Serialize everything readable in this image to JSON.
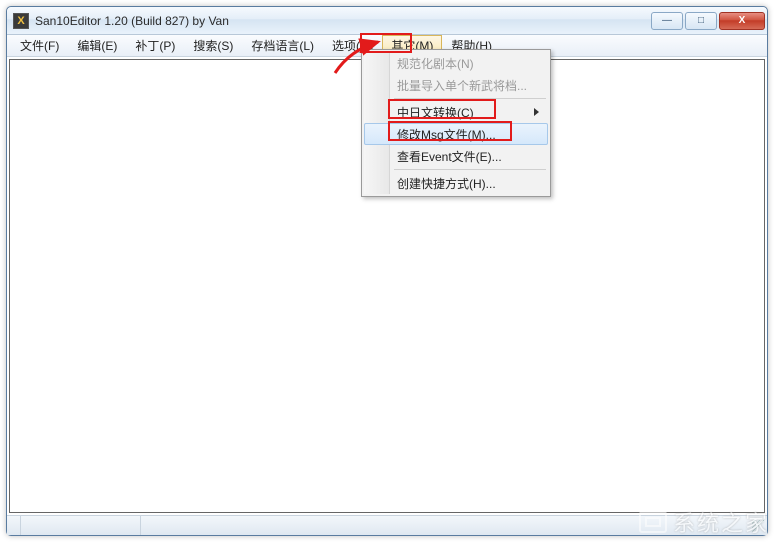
{
  "title": "San10Editor 1.20 (Build 827) by Van",
  "app_icon_letter": "X",
  "window_controls": {
    "min": "—",
    "max": "□",
    "close": "X"
  },
  "menubar": {
    "file": "文件(F)",
    "edit": "编辑(E)",
    "patch": "补丁(P)",
    "search": "搜索(S)",
    "lang": "存档语言(L)",
    "options": "选项(O)",
    "other": "其它(M)",
    "help": "帮助(H)"
  },
  "dropdown": {
    "normalize": "规范化剧本(N)",
    "batchimport": "批量导入单个新武将档...",
    "cjconvert": "中日文转换(C)",
    "editmsg": "修改Msg文件(M)...",
    "viewevent": "查看Event文件(E)...",
    "shortcut": "创建快捷方式(H)..."
  },
  "watermark_text": "系统之家"
}
